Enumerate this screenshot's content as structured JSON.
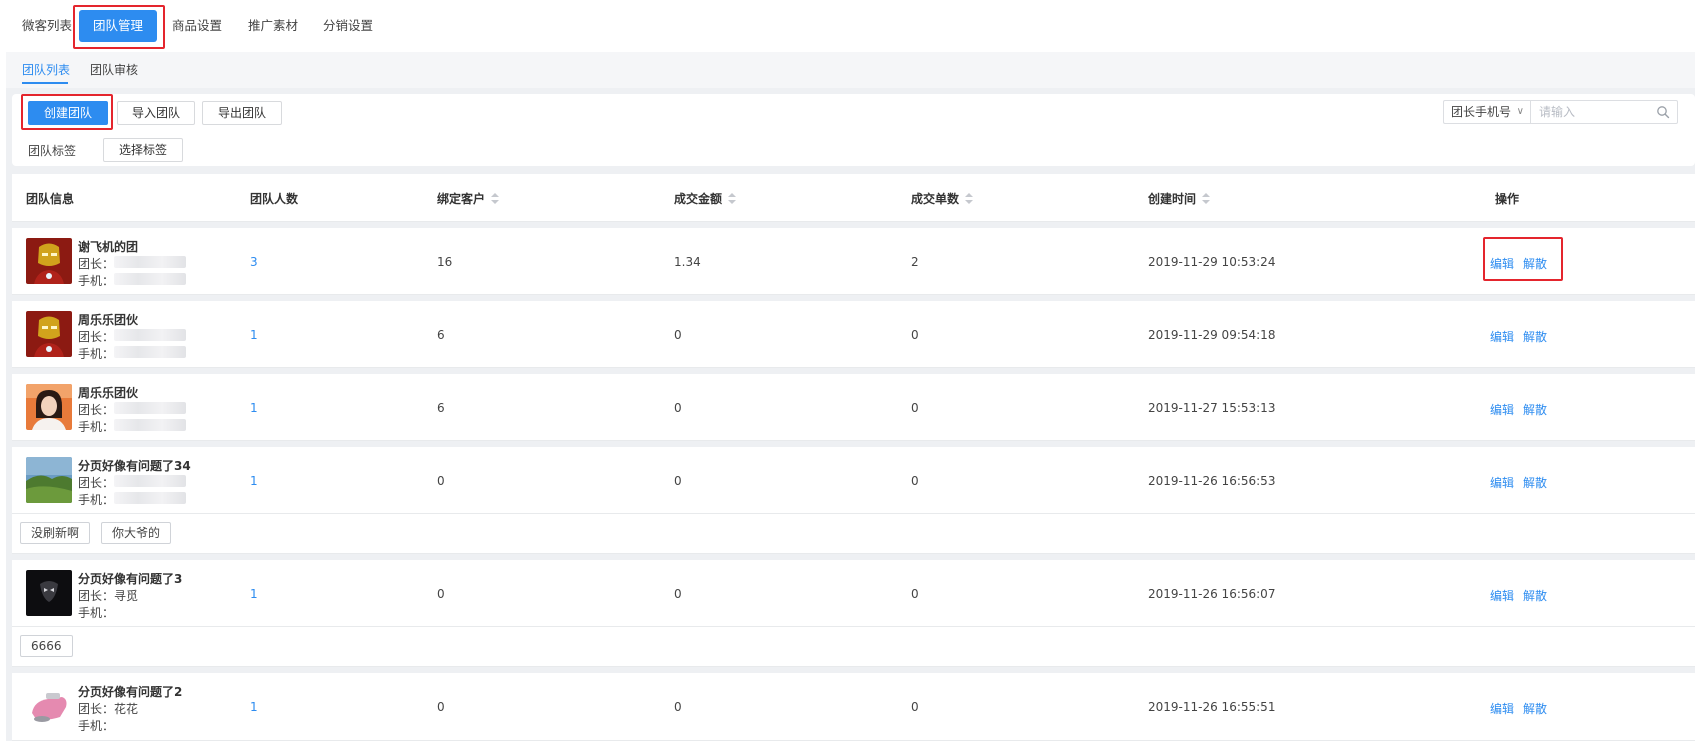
{
  "top_nav": {
    "items": [
      "微客列表",
      "团队管理",
      "商品设置",
      "推广素材",
      "分销设置"
    ],
    "active_index": 1
  },
  "sub_tabs": {
    "items": [
      "团队列表",
      "团队审核"
    ],
    "active_index": 0
  },
  "toolbar": {
    "create_label": "创建团队",
    "import_label": "导入团队",
    "export_label": "导出团队",
    "tag_label": "团队标签",
    "select_tag_label": "选择标签",
    "search_field": "团长手机号",
    "search_placeholder": "请输入"
  },
  "table": {
    "columns": [
      "团队信息",
      "团队人数",
      "绑定客户",
      "成交金额",
      "成交单数",
      "创建时间",
      "操作"
    ],
    "rows": [
      {
        "name": "谢飞机的团",
        "leader_label": "团长：",
        "phone_label": "手机：",
        "members": "3",
        "customers": "16",
        "amount": "1.34",
        "orders": "2",
        "created": "2019-11-29 10:53:24",
        "avatar": "ironman-avatar",
        "tags": []
      },
      {
        "name": "周乐乐团伙",
        "leader_label": "团长：",
        "phone_label": "手机：",
        "members": "1",
        "customers": "6",
        "amount": "0",
        "orders": "0",
        "created": "2019-11-29 09:54:18",
        "avatar": "ironman-avatar",
        "tags": []
      },
      {
        "name": "周乐乐团伙",
        "leader_label": "团长：",
        "phone_label": "手机：",
        "members": "1",
        "customers": "6",
        "amount": "0",
        "orders": "0",
        "created": "2019-11-27 15:53:13",
        "avatar": "woman-avatar",
        "tags": []
      },
      {
        "name": "分页好像有问题了34",
        "leader_label": "团长：",
        "phone_label": "手机：",
        "members": "1",
        "customers": "0",
        "amount": "0",
        "orders": "0",
        "created": "2019-11-26 16:56:53",
        "avatar": "landscape-avatar",
        "tags": [
          "没刷新啊",
          "你大爷的"
        ]
      },
      {
        "name": "分页好像有问题了3",
        "leader_label": "团长：寻觅",
        "phone_label": "手机：",
        "members": "1",
        "customers": "0",
        "amount": "0",
        "orders": "0",
        "created": "2019-11-26 16:56:07",
        "avatar": "dark-avatar",
        "tags": [
          "6666"
        ]
      },
      {
        "name": "分页好像有问题了2",
        "leader_label": "团长：花花",
        "phone_label": "手机：",
        "members": "1",
        "customers": "0",
        "amount": "0",
        "orders": "0",
        "created": "2019-11-26 16:55:51",
        "avatar": "pink-device-avatar",
        "tags": []
      }
    ],
    "ops": {
      "edit": "编辑",
      "dissolve": "解散"
    }
  },
  "colors": {
    "primary": "#2d8cf0",
    "highlight": "#e4252d",
    "background": "#eef0f3"
  }
}
